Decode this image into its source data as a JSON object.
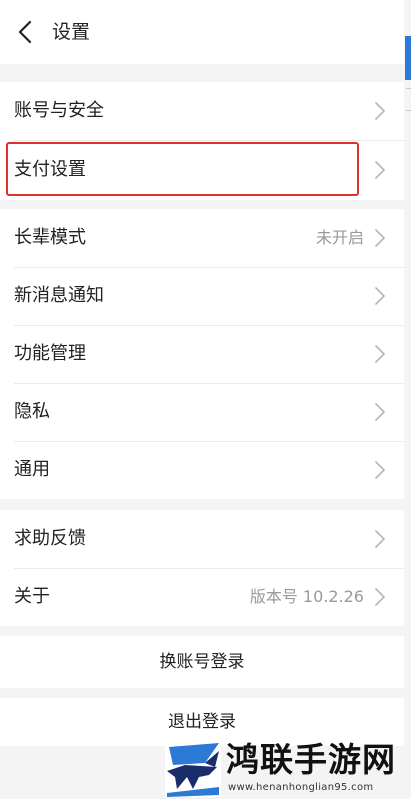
{
  "header": {
    "title": "设置",
    "back_icon": "chevron-left-icon"
  },
  "groups": [
    {
      "items": [
        {
          "label": "账号与安全",
          "value": ""
        },
        {
          "label": "支付设置",
          "value": "",
          "highlighted": true
        }
      ]
    },
    {
      "items": [
        {
          "label": "长辈模式",
          "value": "未开启"
        },
        {
          "label": "新消息通知",
          "value": ""
        },
        {
          "label": "功能管理",
          "value": ""
        },
        {
          "label": "隐私",
          "value": ""
        },
        {
          "label": "通用",
          "value": ""
        }
      ]
    },
    {
      "items": [
        {
          "label": "求助反馈",
          "value": ""
        },
        {
          "label": "关于",
          "value": "版本号 10.2.26"
        }
      ]
    }
  ],
  "actions": {
    "switch_account": "换账号登录",
    "logout": "退出登录"
  },
  "watermark": {
    "title": "鸿联手游网",
    "url": "www.henanhonglian95.com"
  },
  "colors": {
    "highlight": "#e0302c",
    "accent": "#2c7ad6",
    "chevron": "#b5b5b5",
    "value_text": "#9a9a9a"
  }
}
